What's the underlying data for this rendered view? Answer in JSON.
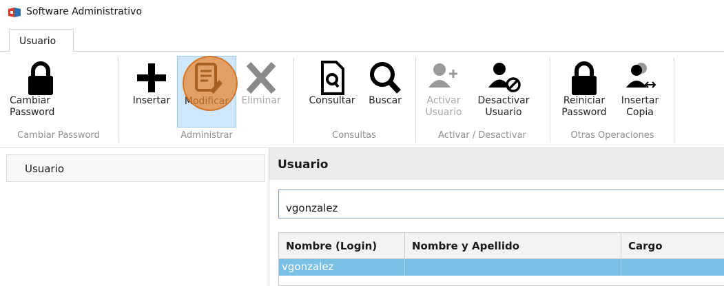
{
  "window": {
    "title": "Software Administrativo"
  },
  "tabs": [
    {
      "label": "Usuario"
    }
  ],
  "ribbon": {
    "groups": [
      {
        "label": "Cambiar Password",
        "buttons": [
          {
            "label": "Cambiar Password",
            "icon": "lock-icon",
            "enabled": true
          }
        ]
      },
      {
        "label": "Administrar",
        "buttons": [
          {
            "label": "Insertar",
            "icon": "plus-icon",
            "enabled": true
          },
          {
            "label": "Modificar",
            "icon": "edit-document-icon",
            "enabled": true,
            "active": true
          },
          {
            "label": "Eliminar",
            "icon": "x-icon",
            "enabled": false
          }
        ]
      },
      {
        "label": "Consultas",
        "buttons": [
          {
            "label": "Consultar",
            "icon": "document-search-icon",
            "enabled": true
          },
          {
            "label": "Buscar",
            "icon": "magnifier-icon",
            "enabled": true
          }
        ]
      },
      {
        "label": "Activar / Desactivar",
        "buttons": [
          {
            "label": "Activar Usuario",
            "icon": "user-add-icon",
            "enabled": false
          },
          {
            "label": "Desactivar Usuario",
            "icon": "user-block-icon",
            "enabled": true
          }
        ]
      },
      {
        "label": "Otras Operaciones",
        "buttons": [
          {
            "label": "Reiniciar Password",
            "icon": "lock-icon",
            "enabled": true
          },
          {
            "label": "Insertar Copia",
            "icon": "user-copy-icon",
            "enabled": true
          }
        ]
      }
    ]
  },
  "sidebar": {
    "items": [
      {
        "label": "Usuario"
      }
    ]
  },
  "main": {
    "title": "Usuario",
    "search": {
      "value": "vgonzalez"
    },
    "table": {
      "columns": [
        "Nombre (Login)",
        "Nombre y Apellido",
        "Cargo"
      ],
      "rows": [
        {
          "login": "vgonzalez",
          "nombre": "",
          "cargo": "",
          "selected": true
        }
      ]
    }
  },
  "colors": {
    "selection": "#79c0e4",
    "active_button": "#cfe7fa",
    "click_marker": "#e9852d"
  }
}
